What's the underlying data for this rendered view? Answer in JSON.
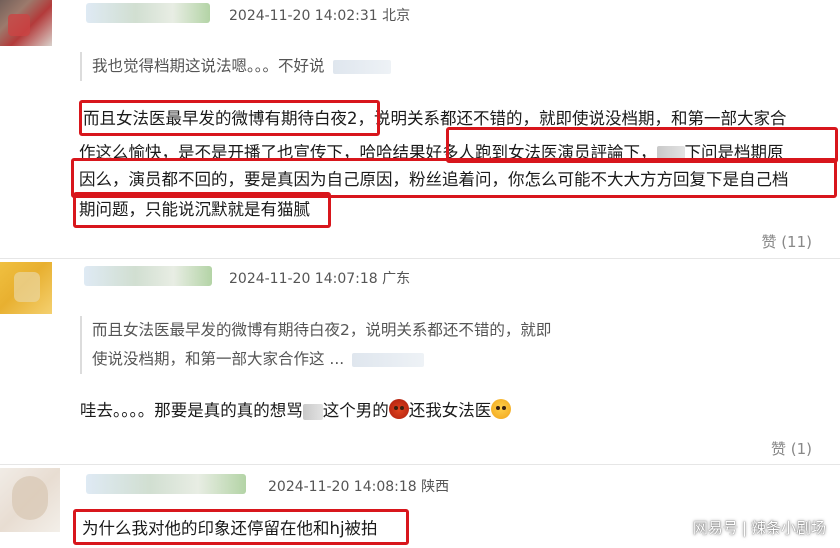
{
  "comments": [
    {
      "meta": "2024-11-20 14:02:31 北京",
      "quote": "我也觉得档期这说法嗯。。。不好说",
      "lines": [
        "而且女法医最早发的微博有期待白夜2，说明关系都还不错的，就即使说没档期，和第一部大家合",
        "作这么愉快，是不是开播了也宣传下，哈哈结果好多人跑到女法医演员評論下，",
        "下问是档期原",
        "因么，演员都不回的，要是真因为自己原因，粉丝追着问，你怎么可能不大大方方回复下是自己档",
        "期问题，只能说沉默就是有猫腻"
      ],
      "likes": "赞 (11)"
    },
    {
      "meta": "2024-11-20 14:07:18 广东",
      "quote_lines": [
        "而且女法医最早发的微博有期待白夜2，说明关系都还不错的，就即",
        "使说没档期，和第一部大家合作这 ..."
      ],
      "text_part1": "哇去。。。。那要是真的真的想骂",
      "text_part2": "这个男的",
      "text_part3": "还我女法医",
      "likes": "赞 (1)"
    },
    {
      "meta": "2024-11-20 14:08:18 陕西",
      "text": "为什么我对他的印象还停留在他和hj被拍"
    }
  ],
  "watermark": {
    "brand": "网易号",
    "sep": "|",
    "author": "辣条小剧场"
  },
  "colors": {
    "highlight": "#d8161c",
    "meta": "#555555",
    "likes": "#888888"
  },
  "icons": [
    "angry-face-emoji",
    "crying-face-emoji"
  ]
}
